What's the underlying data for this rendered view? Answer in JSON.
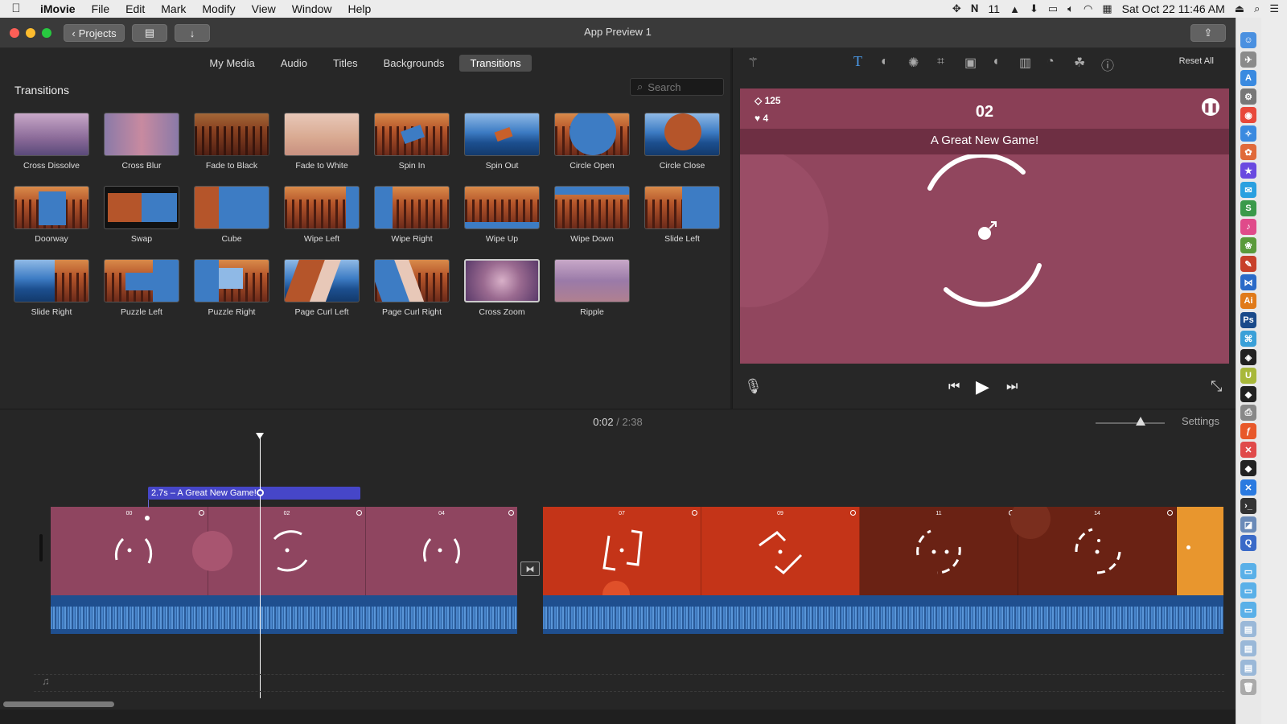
{
  "menubar": {
    "apple": "",
    "app_name": "iMovie",
    "menus": [
      "File",
      "Edit",
      "Mark",
      "Modify",
      "View",
      "Window",
      "Help"
    ],
    "status_num": "11",
    "datetime": "Sat Oct 22  11:46 AM"
  },
  "window": {
    "title": "App Preview 1",
    "projects_btn": "Projects"
  },
  "browser": {
    "tabs": [
      "My Media",
      "Audio",
      "Titles",
      "Backgrounds",
      "Transitions"
    ],
    "active_tab": "Transitions",
    "section_title": "Transitions",
    "search_placeholder": "Search",
    "transitions": [
      {
        "label": "Cross Dissolve"
      },
      {
        "label": "Cross Blur"
      },
      {
        "label": "Fade to Black"
      },
      {
        "label": "Fade to White"
      },
      {
        "label": "Spin In"
      },
      {
        "label": "Spin Out"
      },
      {
        "label": "Circle Open"
      },
      {
        "label": "Circle Close"
      },
      {
        "label": "Doorway"
      },
      {
        "label": "Swap"
      },
      {
        "label": "Cube"
      },
      {
        "label": "Wipe Left"
      },
      {
        "label": "Wipe Right"
      },
      {
        "label": "Wipe Up"
      },
      {
        "label": "Wipe Down"
      },
      {
        "label": "Slide Left"
      },
      {
        "label": "Slide Right"
      },
      {
        "label": "Puzzle Left"
      },
      {
        "label": "Puzzle Right"
      },
      {
        "label": "Page Curl Left"
      },
      {
        "label": "Page Curl Right"
      },
      {
        "label": "Cross Zoom"
      },
      {
        "label": "Ripple"
      }
    ],
    "selected_transition": "Cross Zoom"
  },
  "viewer": {
    "reset_all": "Reset All",
    "game": {
      "gems": "125",
      "hearts": "4",
      "score": "02",
      "title": "A Great New Game!"
    }
  },
  "timeline": {
    "current_time": "0:02",
    "separator": "/",
    "duration": "2:38",
    "settings": "Settings",
    "title_clip": "2.7s – A Great New Game!",
    "clip1_frames": [
      "00",
      "02",
      "04"
    ],
    "clip2_frames": [
      "07",
      "09",
      "11",
      "14"
    ],
    "transition_icon": "⧓"
  },
  "colors": {
    "game_bg": "#91465e",
    "clip1": "#8f4560",
    "clip2_a": "#c43418",
    "clip2_b": "#6a2214",
    "clip2_c": "#e8962e",
    "title_clip": "#4646c8",
    "audio": "#1f4f8f"
  }
}
